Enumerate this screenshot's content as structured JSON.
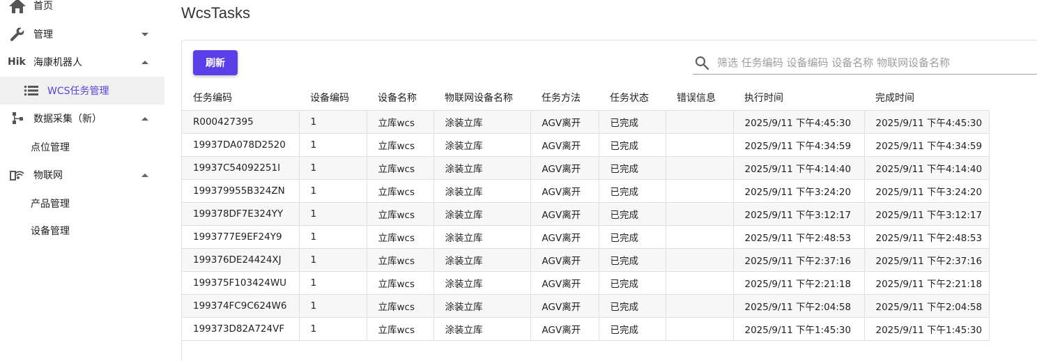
{
  "sidebar": {
    "home": "首页",
    "manage": "管理",
    "hik_prefix": "Hik",
    "hik": "海康机器人",
    "wcs_tasks": "WCS任务管理",
    "data_collect": "数据采集（新）",
    "point_manage": "点位管理",
    "iot": "物联网",
    "product_manage": "产品管理",
    "device_manage": "设备管理"
  },
  "page": {
    "title": "WcsTasks",
    "refresh_label": "刷新",
    "search_placeholder": "筛选 任务编码 设备编码 设备名称 物联网设备名称"
  },
  "colors": {
    "accent": "#5b3fe8",
    "active_text": "#5b3fd9"
  },
  "table": {
    "headers": [
      "任务编码",
      "设备编码",
      "设备名称",
      "物联网设备名称",
      "任务方法",
      "任务状态",
      "错误信息",
      "执行时间",
      "完成时间"
    ],
    "rows": [
      [
        "R000427395",
        "1",
        "立库wcs",
        "涂装立库",
        "AGV离开",
        "已完成",
        "",
        "2025/9/11 下午4:45:30",
        "2025/9/11 下午4:45:30"
      ],
      [
        "19937DA078D2520",
        "1",
        "立库wcs",
        "涂装立库",
        "AGV离开",
        "已完成",
        "",
        "2025/9/11 下午4:34:59",
        "2025/9/11 下午4:34:59"
      ],
      [
        "19937C54092251I",
        "1",
        "立库wcs",
        "涂装立库",
        "AGV离开",
        "已完成",
        "",
        "2025/9/11 下午4:14:40",
        "2025/9/11 下午4:14:40"
      ],
      [
        "199379955B324ZN",
        "1",
        "立库wcs",
        "涂装立库",
        "AGV离开",
        "已完成",
        "",
        "2025/9/11 下午3:24:20",
        "2025/9/11 下午3:24:20"
      ],
      [
        "199378DF7E324YY",
        "1",
        "立库wcs",
        "涂装立库",
        "AGV离开",
        "已完成",
        "",
        "2025/9/11 下午3:12:17",
        "2025/9/11 下午3:12:17"
      ],
      [
        "1993777E9EF24Y9",
        "1",
        "立库wcs",
        "涂装立库",
        "AGV离开",
        "已完成",
        "",
        "2025/9/11 下午2:48:53",
        "2025/9/11 下午2:48:53"
      ],
      [
        "199376DE24424XJ",
        "1",
        "立库wcs",
        "涂装立库",
        "AGV离开",
        "已完成",
        "",
        "2025/9/11 下午2:37:16",
        "2025/9/11 下午2:37:16"
      ],
      [
        "199375F103424WU",
        "1",
        "立库wcs",
        "涂装立库",
        "AGV离开",
        "已完成",
        "",
        "2025/9/11 下午2:21:18",
        "2025/9/11 下午2:21:18"
      ],
      [
        "199374FC9C624W6",
        "1",
        "立库wcs",
        "涂装立库",
        "AGV离开",
        "已完成",
        "",
        "2025/9/11 下午2:04:58",
        "2025/9/11 下午2:04:58"
      ],
      [
        "199373D82A724VF",
        "1",
        "立库wcs",
        "涂装立库",
        "AGV离开",
        "已完成",
        "",
        "2025/9/11 下午1:45:30",
        "2025/9/11 下午1:45:30"
      ]
    ]
  }
}
